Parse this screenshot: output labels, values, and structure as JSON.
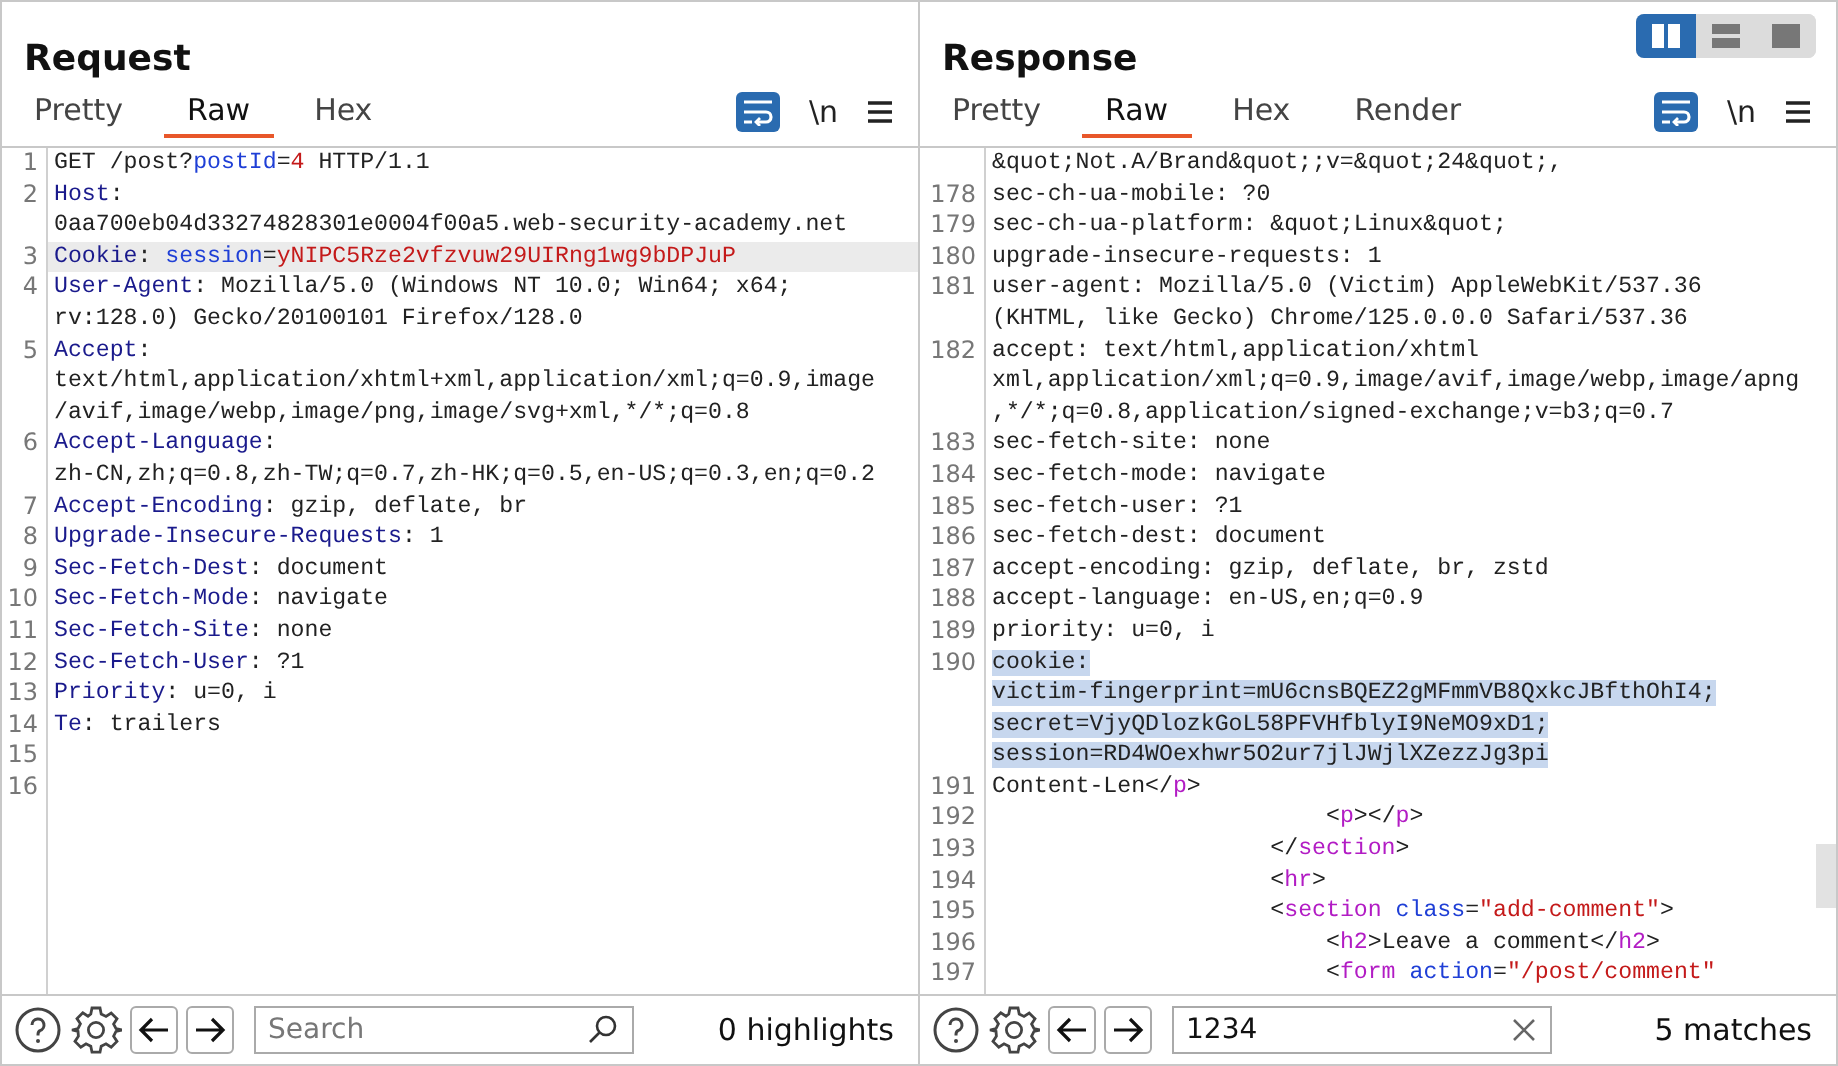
{
  "panels": [
    {
      "title": "Request",
      "tabs": [
        {
          "label": "Pretty",
          "selected": false
        },
        {
          "label": "Raw",
          "selected": true
        },
        {
          "label": "Hex",
          "selected": false
        }
      ],
      "newline_toggle": "\\n",
      "wrap_on": true,
      "lines": [
        {
          "number": "1",
          "kind": "normal",
          "segments": [
            {
              "kind": "plain",
              "text": "GET /post?"
            },
            {
              "kind": "param",
              "text": "postId"
            },
            {
              "kind": "plain",
              "text": "="
            },
            {
              "kind": "value",
              "text": "4"
            },
            {
              "kind": "plain",
              "text": " HTTP/1.1"
            }
          ]
        },
        {
          "number": "2",
          "kind": "normal",
          "segments": [
            {
              "kind": "name",
              "text": "Host"
            },
            {
              "kind": "plain",
              "text": ":"
            }
          ]
        },
        {
          "kind": "normal",
          "segments": [
            {
              "kind": "plain",
              "text": "0aa700eb04d33274828301e0004f00a5.web-security-academy.net"
            }
          ]
        },
        {
          "number": "3",
          "kind": "cursor",
          "segments": [
            {
              "kind": "name",
              "text": "Cookie"
            },
            {
              "kind": "plain",
              "text": ": "
            },
            {
              "kind": "param",
              "text": "session"
            },
            {
              "kind": "plain",
              "text": "="
            },
            {
              "kind": "value",
              "text": "yNIPC5Rze2vfzvuw29UIRng1wg9bDPJuP"
            }
          ]
        },
        {
          "number": "4",
          "kind": "normal",
          "segments": [
            {
              "kind": "name",
              "text": "User-Agent"
            },
            {
              "kind": "plain",
              "text": ": Mozilla/5.0 (Windows NT 10.0; Win64; x64;"
            }
          ]
        },
        {
          "kind": "normal",
          "segments": [
            {
              "kind": "plain",
              "text": "rv:128.0) Gecko/20100101 Firefox/128.0"
            }
          ]
        },
        {
          "number": "5",
          "kind": "normal",
          "segments": [
            {
              "kind": "name",
              "text": "Accept"
            },
            {
              "kind": "plain",
              "text": ":"
            }
          ]
        },
        {
          "kind": "normal",
          "segments": [
            {
              "kind": "plain",
              "text": "text/html,application/xhtml+xml,application/xml;q=0.9,image"
            }
          ]
        },
        {
          "kind": "normal",
          "segments": [
            {
              "kind": "plain",
              "text": "/avif,image/webp,image/png,image/svg+xml,*/*;q=0.8"
            }
          ]
        },
        {
          "number": "6",
          "kind": "normal",
          "segments": [
            {
              "kind": "name",
              "text": "Accept-Language"
            },
            {
              "kind": "plain",
              "text": ":"
            }
          ]
        },
        {
          "kind": "normal",
          "segments": [
            {
              "kind": "plain",
              "text": "zh-CN,zh;q=0.8,zh-TW;q=0.7,zh-HK;q=0.5,en-US;q=0.3,en;q=0.2"
            }
          ]
        },
        {
          "number": "7",
          "kind": "normal",
          "segments": [
            {
              "kind": "name",
              "text": "Accept-Encoding"
            },
            {
              "kind": "plain",
              "text": ": gzip, deflate, br"
            }
          ]
        },
        {
          "number": "8",
          "kind": "normal",
          "segments": [
            {
              "kind": "name",
              "text": "Upgrade-Insecure-Requests"
            },
            {
              "kind": "plain",
              "text": ": 1"
            }
          ]
        },
        {
          "number": "9",
          "kind": "normal",
          "segments": [
            {
              "kind": "name",
              "text": "Sec-Fetch-Dest"
            },
            {
              "kind": "plain",
              "text": ": document"
            }
          ]
        },
        {
          "number": "10",
          "kind": "normal",
          "segments": [
            {
              "kind": "name",
              "text": "Sec-Fetch-Mode"
            },
            {
              "kind": "plain",
              "text": ": navigate"
            }
          ]
        },
        {
          "number": "11",
          "kind": "normal",
          "segments": [
            {
              "kind": "name",
              "text": "Sec-Fetch-Site"
            },
            {
              "kind": "plain",
              "text": ": none"
            }
          ]
        },
        {
          "number": "12",
          "kind": "normal",
          "segments": [
            {
              "kind": "name",
              "text": "Sec-Fetch-User"
            },
            {
              "kind": "plain",
              "text": ": ?1"
            }
          ]
        },
        {
          "number": "13",
          "kind": "normal",
          "segments": [
            {
              "kind": "name",
              "text": "Priority"
            },
            {
              "kind": "plain",
              "text": ": u=0, i"
            }
          ]
        },
        {
          "number": "14",
          "kind": "normal",
          "segments": [
            {
              "kind": "name",
              "text": "Te"
            },
            {
              "kind": "plain",
              "text": ": trailers"
            }
          ]
        },
        {
          "number": "15",
          "kind": "normal"
        },
        {
          "number": "16",
          "kind": "normal"
        }
      ],
      "search": {
        "placeholder": "Search"
      },
      "status": "0 highlights"
    },
    {
      "title": "Response",
      "layout_buttons": [
        {
          "selected": true
        },
        {
          "selected": false
        },
        {
          "selected": false
        }
      ],
      "tabs": [
        {
          "label": "Pretty",
          "selected": false
        },
        {
          "label": "Raw",
          "selected": true
        },
        {
          "label": "Hex",
          "selected": false
        },
        {
          "label": "Render",
          "selected": false
        }
      ],
      "newline_toggle": "\\n",
      "wrap_on": true,
      "scrollbar": true,
      "lines": [
        {
          "kind": "normal",
          "segments": [
            {
              "kind": "plain",
              "text": "&quot;Not.A/Brand&quot;;v=&quot;24&quot;,"
            }
          ]
        },
        {
          "number": "178",
          "kind": "normal",
          "segments": [
            {
              "kind": "plain",
              "text": "sec-ch-ua-mobile: ?0"
            }
          ]
        },
        {
          "number": "179",
          "kind": "normal",
          "segments": [
            {
              "kind": "plain",
              "text": "sec-ch-ua-platform: &quot;Linux&quot;"
            }
          ]
        },
        {
          "number": "180",
          "kind": "normal",
          "segments": [
            {
              "kind": "plain",
              "text": "upgrade-insecure-requests: 1"
            }
          ]
        },
        {
          "number": "181",
          "kind": "normal",
          "segments": [
            {
              "kind": "plain",
              "text": "user-agent: Mozilla/5.0 (Victim) AppleWebKit/537.36"
            }
          ]
        },
        {
          "kind": "normal",
          "segments": [
            {
              "kind": "plain",
              "text": "(KHTML, like Gecko) Chrome/125.0.0.0 Safari/537.36"
            }
          ]
        },
        {
          "number": "182",
          "kind": "normal",
          "segments": [
            {
              "kind": "plain",
              "text": "accept: text/html,application/xhtml"
            }
          ]
        },
        {
          "kind": "normal",
          "segments": [
            {
              "kind": "plain",
              "text": "xml,application/xml;q=0.9,image/avif,image/webp,image/apng"
            }
          ]
        },
        {
          "kind": "normal",
          "segments": [
            {
              "kind": "plain",
              "text": ",*/*;q=0.8,application/signed-exchange;v=b3;q=0.7"
            }
          ]
        },
        {
          "number": "183",
          "kind": "normal",
          "segments": [
            {
              "kind": "plain",
              "text": "sec-fetch-site: none"
            }
          ]
        },
        {
          "number": "184",
          "kind": "normal",
          "segments": [
            {
              "kind": "plain",
              "text": "sec-fetch-mode: navigate"
            }
          ]
        },
        {
          "number": "185",
          "kind": "normal",
          "segments": [
            {
              "kind": "plain",
              "text": "sec-fetch-user: ?1"
            }
          ]
        },
        {
          "number": "186",
          "kind": "normal",
          "segments": [
            {
              "kind": "plain",
              "text": "sec-fetch-dest: document"
            }
          ]
        },
        {
          "number": "187",
          "kind": "normal",
          "segments": [
            {
              "kind": "plain",
              "text": "accept-encoding: gzip, deflate, br, zstd"
            }
          ]
        },
        {
          "number": "188",
          "kind": "normal",
          "segments": [
            {
              "kind": "plain",
              "text": "accept-language: en-US,en;q=0.9"
            }
          ]
        },
        {
          "number": "189",
          "kind": "normal",
          "segments": [
            {
              "kind": "plain",
              "text": "priority: u=0, i"
            }
          ]
        },
        {
          "number": "190",
          "kind": "selection",
          "segments": [
            {
              "kind": "plain",
              "text": "cookie:"
            }
          ]
        },
        {
          "kind": "selection",
          "segments": [
            {
              "kind": "plain",
              "text": "victim-fingerprint=mU6cnsBQEZ2gMFmmVB8QxkcJBfthOhI4;"
            }
          ]
        },
        {
          "kind": "selection",
          "segments": [
            {
              "kind": "plain",
              "text": "secret=VjyQDlozkGoL58PFVHfblyI9NeMO9xD1;"
            }
          ]
        },
        {
          "kind": "selection",
          "segments": [
            {
              "kind": "plain",
              "text": "session=RD4WOexhwr5O2ur7jlJWjlXZezzJg3pi"
            }
          ]
        },
        {
          "number": "191",
          "kind": "normal",
          "segments": [
            {
              "kind": "plain",
              "text": "Content-Len</"
            },
            {
              "kind": "tag",
              "text": "p"
            },
            {
              "kind": "plain",
              "text": ">"
            }
          ]
        },
        {
          "number": "192",
          "kind": "normal",
          "segments": [
            {
              "kind": "plain",
              "text": "                        <"
            },
            {
              "kind": "tag",
              "text": "p"
            },
            {
              "kind": "plain",
              "text": "></"
            },
            {
              "kind": "tag",
              "text": "p"
            },
            {
              "kind": "plain",
              "text": ">"
            }
          ]
        },
        {
          "number": "193",
          "kind": "normal",
          "segments": [
            {
              "kind": "plain",
              "text": "                    </"
            },
            {
              "kind": "tag",
              "text": "section"
            },
            {
              "kind": "plain",
              "text": ">"
            }
          ]
        },
        {
          "number": "194",
          "kind": "normal",
          "segments": [
            {
              "kind": "plain",
              "text": "                    <"
            },
            {
              "kind": "tag",
              "text": "hr"
            },
            {
              "kind": "plain",
              "text": ">"
            }
          ]
        },
        {
          "number": "195",
          "kind": "normal",
          "segments": [
            {
              "kind": "plain",
              "text": "                    <"
            },
            {
              "kind": "tag",
              "text": "section "
            },
            {
              "kind": "param",
              "text": "class"
            },
            {
              "kind": "plain",
              "text": "="
            },
            {
              "kind": "value",
              "text": "\"add-comment\""
            },
            {
              "kind": "plain",
              "text": ">"
            }
          ]
        },
        {
          "number": "196",
          "kind": "normal",
          "segments": [
            {
              "kind": "plain",
              "text": "                        <"
            },
            {
              "kind": "tag",
              "text": "h2"
            },
            {
              "kind": "plain",
              "text": ">Leave a comment</"
            },
            {
              "kind": "tag",
              "text": "h2"
            },
            {
              "kind": "plain",
              "text": ">"
            }
          ]
        },
        {
          "number": "197",
          "kind": "normal",
          "segments": [
            {
              "kind": "plain",
              "text": "                        <"
            },
            {
              "kind": "tag",
              "text": "form "
            },
            {
              "kind": "param",
              "text": "action"
            },
            {
              "kind": "plain",
              "text": "="
            },
            {
              "kind": "value",
              "text": "\"/post/comment\""
            }
          ]
        }
      ],
      "search": {
        "value": "1234"
      },
      "status": "5 matches"
    }
  ]
}
